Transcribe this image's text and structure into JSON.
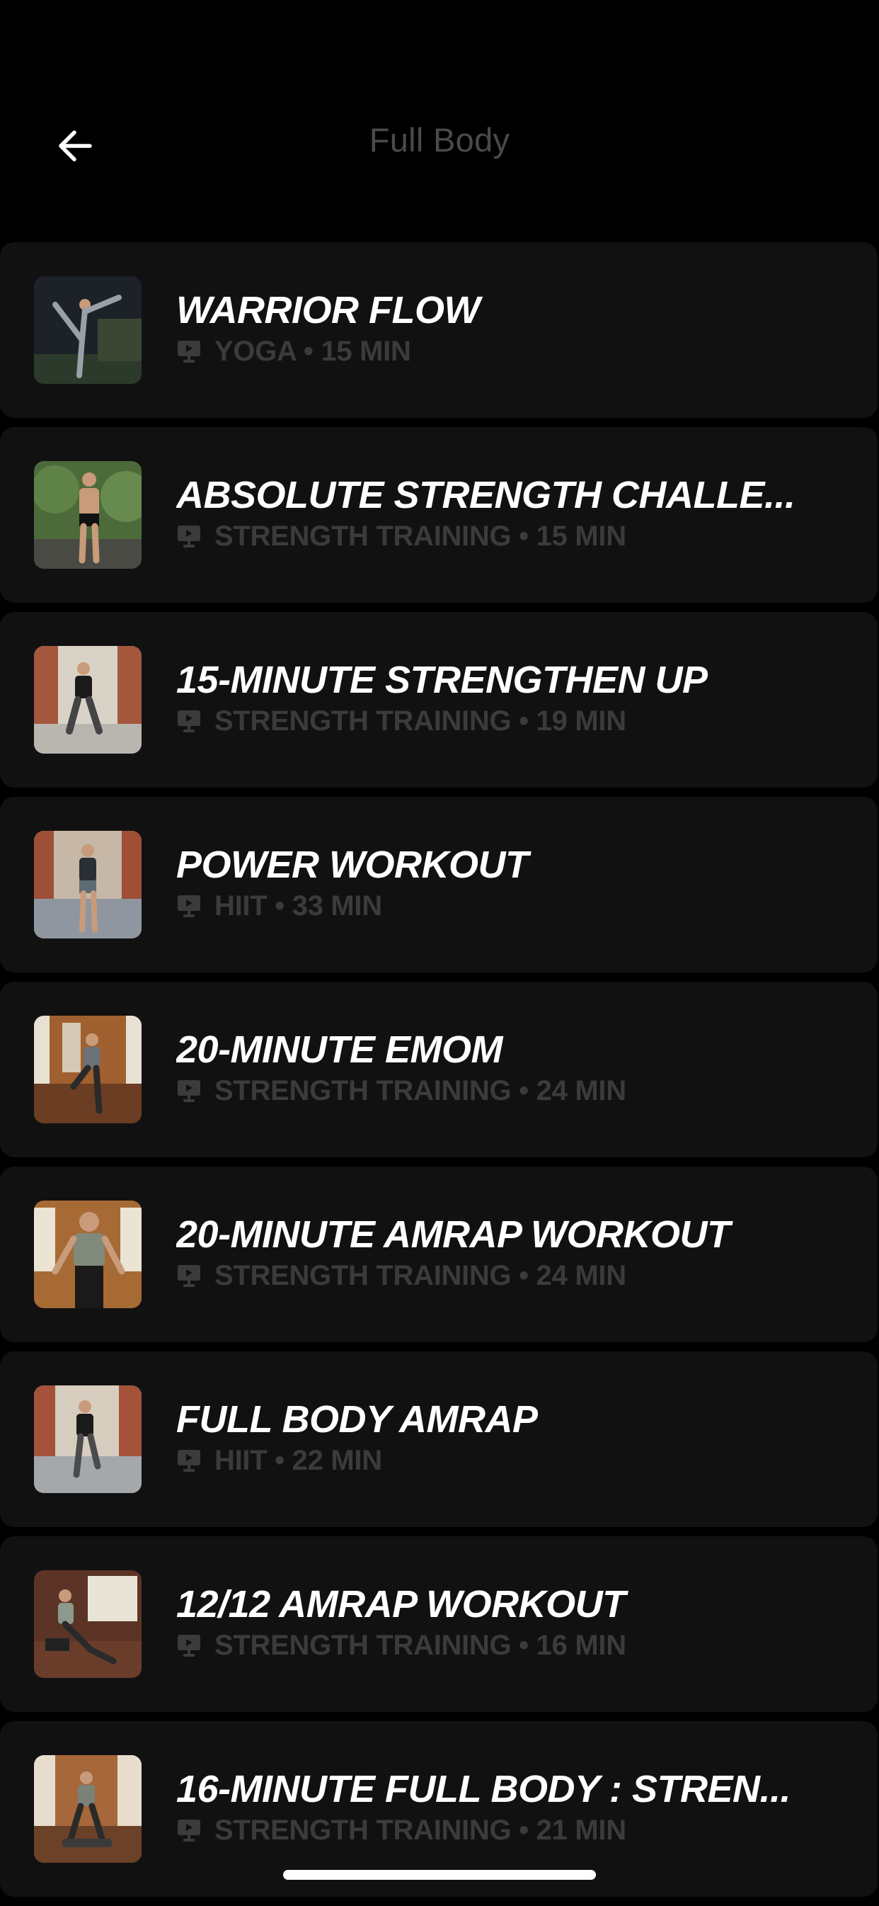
{
  "header": {
    "title": "Full Body",
    "back_icon": "arrow-left-icon"
  },
  "colors": {
    "background": "#000000",
    "card": "#111112",
    "title_text": "#ffffff",
    "meta_text": "#3b3b3d",
    "header_title": "#4a4a4c"
  },
  "workouts": [
    {
      "title": "WARRIOR FLOW",
      "meta": "YOGA • 15 MIN",
      "meta_icon": "video-icon"
    },
    {
      "title": "ABSOLUTE STRENGTH CHALLE...",
      "meta": "STRENGTH TRAINING • 15 MIN",
      "meta_icon": "video-icon"
    },
    {
      "title": "15-MINUTE STRENGTHEN UP",
      "meta": "STRENGTH TRAINING • 19 MIN",
      "meta_icon": "video-icon"
    },
    {
      "title": "POWER WORKOUT",
      "meta": "HIIT • 33 MIN",
      "meta_icon": "video-icon"
    },
    {
      "title": "20-MINUTE EMOM",
      "meta": "STRENGTH TRAINING • 24 MIN",
      "meta_icon": "video-icon"
    },
    {
      "title": "20-MINUTE AMRAP WORKOUT",
      "meta": "STRENGTH TRAINING • 24 MIN",
      "meta_icon": "video-icon"
    },
    {
      "title": "FULL BODY AMRAP",
      "meta": "HIIT • 22 MIN",
      "meta_icon": "video-icon"
    },
    {
      "title": "12/12 AMRAP WORKOUT",
      "meta": "STRENGTH TRAINING • 16 MIN",
      "meta_icon": "video-icon"
    },
    {
      "title": "16-MINUTE FULL BODY : STREN...",
      "meta": "STRENGTH TRAINING • 21 MIN",
      "meta_icon": "video-icon"
    }
  ]
}
